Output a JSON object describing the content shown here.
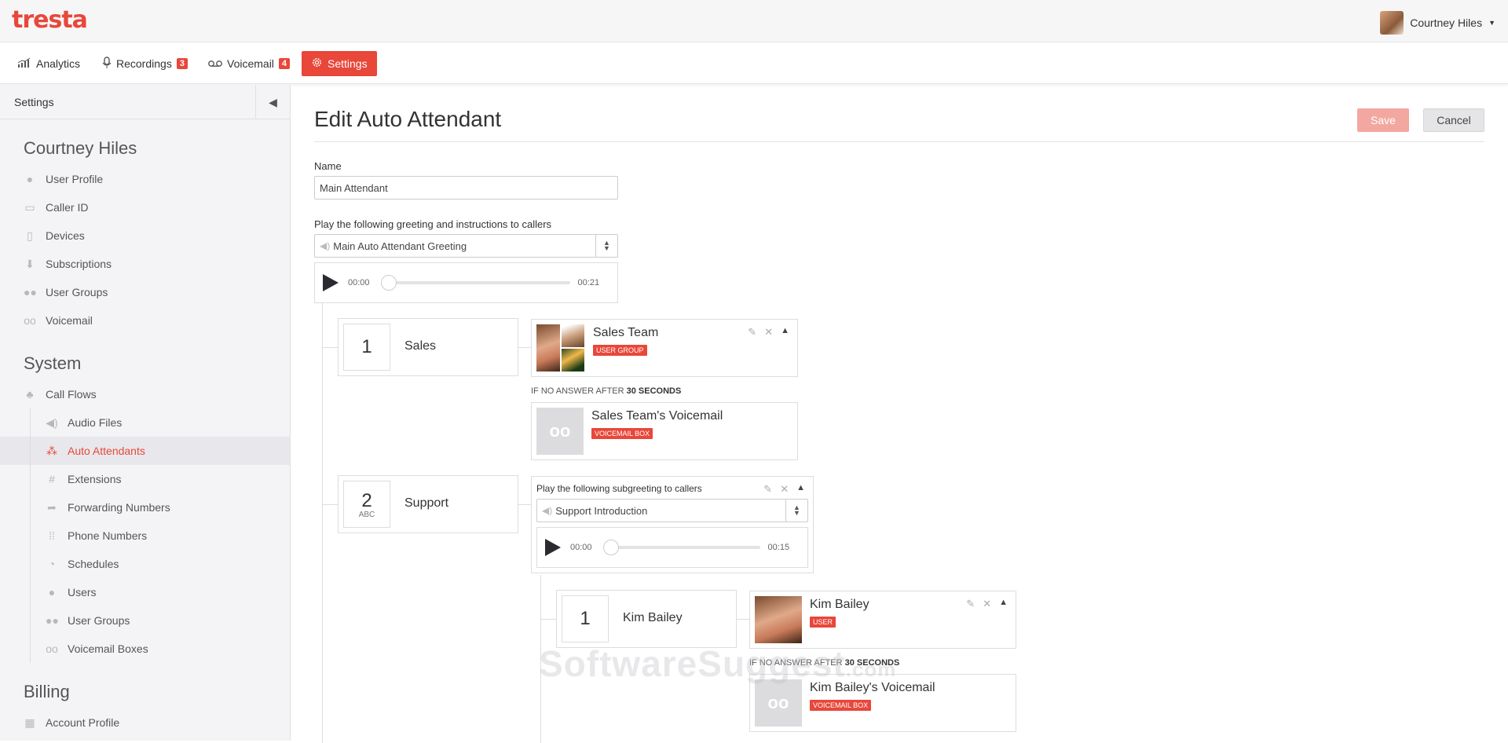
{
  "brand": {
    "logo": "tresta",
    "accent": "#e8473a"
  },
  "user": {
    "name": "Courtney Hiles"
  },
  "nav": {
    "analytics": "Analytics",
    "recordings": "Recordings",
    "recordings_count": "3",
    "voicemail": "Voicemail",
    "voicemail_count": "4",
    "settings": "Settings"
  },
  "sidebar": {
    "header": "Settings",
    "user_section": "Courtney Hiles",
    "user_items": [
      "User Profile",
      "Caller ID",
      "Devices",
      "Subscriptions",
      "User Groups",
      "Voicemail"
    ],
    "system_section": "System",
    "call_flows": "Call Flows",
    "system_items": [
      "Audio Files",
      "Auto Attendants",
      "Extensions",
      "Forwarding Numbers",
      "Phone Numbers",
      "Schedules",
      "Users",
      "User Groups",
      "Voicemail Boxes"
    ],
    "active_item": "Auto Attendants",
    "billing_section": "Billing",
    "billing_items": [
      "Account Profile"
    ]
  },
  "form": {
    "title": "Edit Auto Attendant",
    "save": "Save",
    "cancel": "Cancel",
    "name_label": "Name",
    "name_value": "Main Attendant",
    "greeting_label": "Play the following greeting and instructions to callers",
    "greeting_value": "Main Auto Attendant Greeting",
    "greeting_start": "00:00",
    "greeting_end": "00:21"
  },
  "options": [
    {
      "digit": "1",
      "letters": "",
      "name": "Sales",
      "dest_name": "Sales Team",
      "dest_tag": "User Group",
      "no_answer_prefix": "If no answer after",
      "no_answer_time": "30 Seconds",
      "fallback_name": "Sales Team's Voicemail",
      "fallback_tag": "Voicemail Box"
    },
    {
      "digit": "2",
      "letters": "ABC",
      "name": "Support",
      "subgreeting_label": "Play the following subgreeting to callers",
      "subgreeting_value": "Support Introduction",
      "sub_start": "00:00",
      "sub_end": "00:15",
      "sub_options": [
        {
          "digit": "1",
          "name": "Kim Bailey",
          "dest_name": "Kim Bailey",
          "dest_tag": "User",
          "no_answer_prefix": "If no answer after",
          "no_answer_time": "30 Seconds",
          "fallback_name": "Kim Bailey's Voicemail",
          "fallback_tag": "Voicemail Box"
        }
      ]
    }
  ],
  "watermark": {
    "main": "SoftwareSuggest",
    "suffix": ".com"
  }
}
